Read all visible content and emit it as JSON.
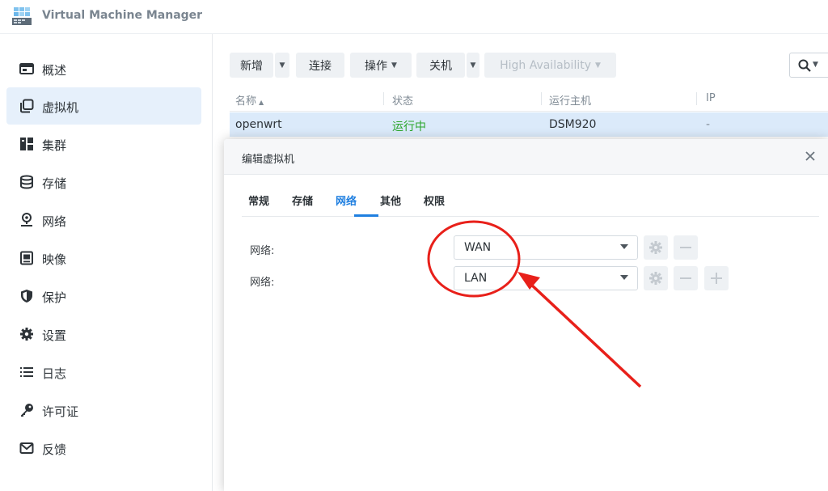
{
  "app": {
    "title": "Virtual Machine Manager"
  },
  "sidebar": {
    "items": [
      {
        "label": "概述",
        "icon": "overview-icon"
      },
      {
        "label": "虚拟机",
        "icon": "virtual-machine-icon",
        "active": true
      },
      {
        "label": "集群",
        "icon": "cluster-icon"
      },
      {
        "label": "存储",
        "icon": "storage-icon"
      },
      {
        "label": "网络",
        "icon": "network-icon"
      },
      {
        "label": "映像",
        "icon": "image-icon"
      },
      {
        "label": "保护",
        "icon": "shield-icon"
      },
      {
        "label": "设置",
        "icon": "gear-icon"
      },
      {
        "label": "日志",
        "icon": "list-icon"
      },
      {
        "label": "许可证",
        "icon": "key-icon"
      },
      {
        "label": "反馈",
        "icon": "mail-icon"
      }
    ]
  },
  "toolbar": {
    "new_label": "新增",
    "connect_label": "连接",
    "action_label": "操作",
    "shutdown_label": "关机",
    "ha_label": "High Availability"
  },
  "table": {
    "headers": [
      "名称",
      "状态",
      "运行主机",
      "IP"
    ],
    "rows": [
      {
        "name": "openwrt",
        "status": "运行中",
        "host": "DSM920",
        "ip": "-"
      }
    ]
  },
  "modal": {
    "title": "编辑虚拟机",
    "tabs": [
      "常规",
      "存储",
      "网络",
      "其他",
      "权限"
    ],
    "active_tab": "网络",
    "networks": [
      {
        "label": "网络:",
        "value": "WAN"
      },
      {
        "label": "网络:",
        "value": "LAN"
      }
    ]
  },
  "colors": {
    "accent": "#1f7fe0",
    "running": "#2aa52a",
    "annotation": "#e8201a",
    "selected_row": "#dbeafa"
  }
}
